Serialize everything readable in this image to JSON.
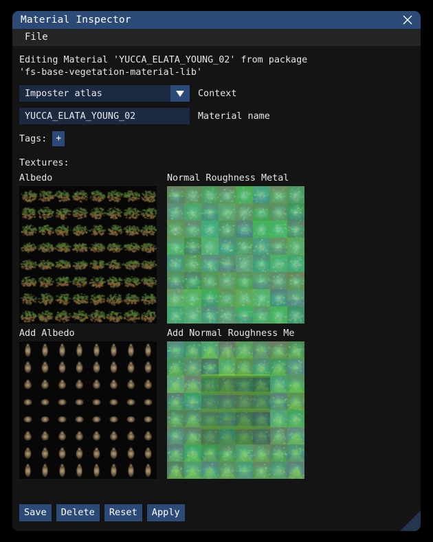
{
  "window": {
    "title": "Material Inspector",
    "close_icon": "close-x-icon"
  },
  "menubar": {
    "items": [
      {
        "label": "File"
      }
    ]
  },
  "description": {
    "line1": "Editing Material 'YUCCA_ELATA_YOUNG_02' from package",
    "line2": "'fs-base-vegetation-material-lib'"
  },
  "form": {
    "context": {
      "value": "Imposter atlas",
      "label": "Context",
      "arrow_icon": "chevron-down-icon"
    },
    "material_name": {
      "value": "YUCCA_ELATA_YOUNG_02",
      "placeholder": "",
      "label": "Material name"
    },
    "tags": {
      "label": "Tags:",
      "add_button": "+"
    }
  },
  "textures": {
    "heading": "Textures:",
    "slots": [
      {
        "label": "Albedo",
        "kind": "albedo"
      },
      {
        "label": "Normal Roughness Metal",
        "kind": "normal"
      },
      {
        "label": "Add Albedo",
        "kind": "add_albedo"
      },
      {
        "label": "Add Normal Roughness Me",
        "kind": "add_normal"
      }
    ]
  },
  "footer": {
    "buttons": [
      {
        "label": "Save"
      },
      {
        "label": "Delete"
      },
      {
        "label": "Reset"
      },
      {
        "label": "Apply"
      }
    ]
  },
  "colors": {
    "titlebar": "#2c4a78",
    "accent": "#2c4a78",
    "window_bg": "#141414",
    "menubar_bg": "#242424",
    "field_bg": "#1b2a40",
    "text": "#e6e6e6",
    "grip": "#24354f"
  }
}
